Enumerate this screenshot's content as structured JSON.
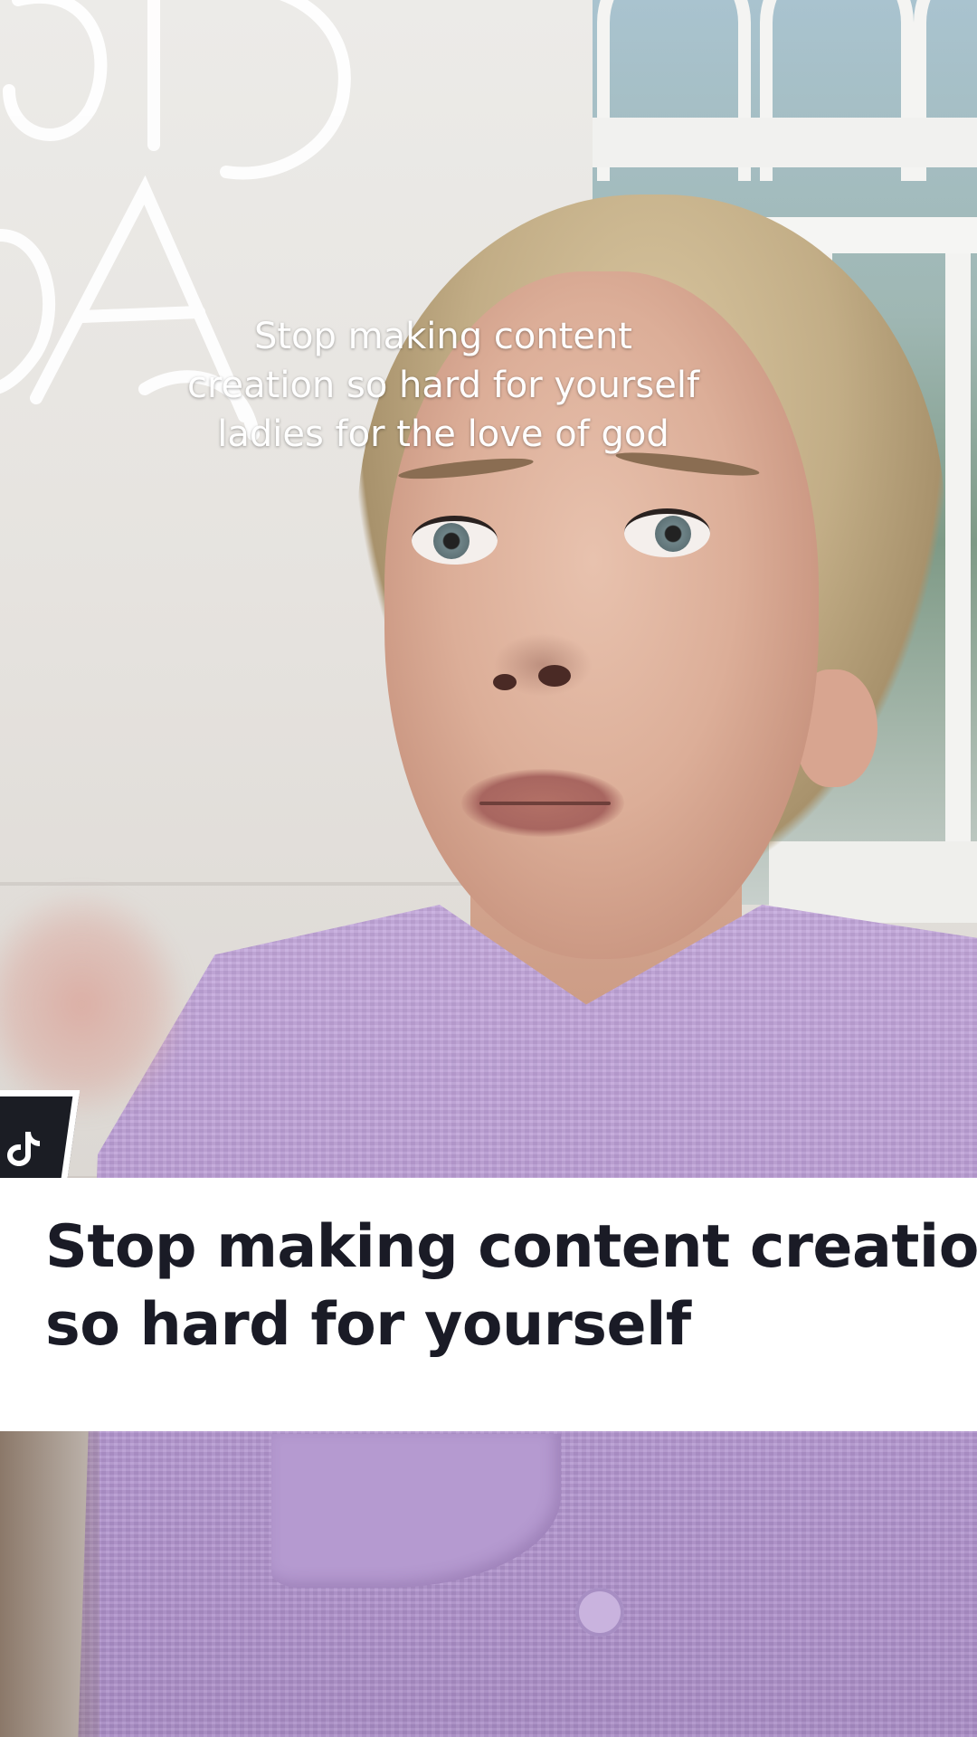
{
  "video": {
    "overlay_caption_lines": [
      "Stop making content",
      "creation so hard for yourself",
      "ladies for the love of god"
    ]
  },
  "badge": {
    "icon": "tiktok-logo-icon",
    "color": "#1b1d24"
  },
  "headline": {
    "lines": [
      "Stop making content creation",
      "so hard for yourself"
    ],
    "text_color": "#1a1b26",
    "background": "#ffffff"
  }
}
